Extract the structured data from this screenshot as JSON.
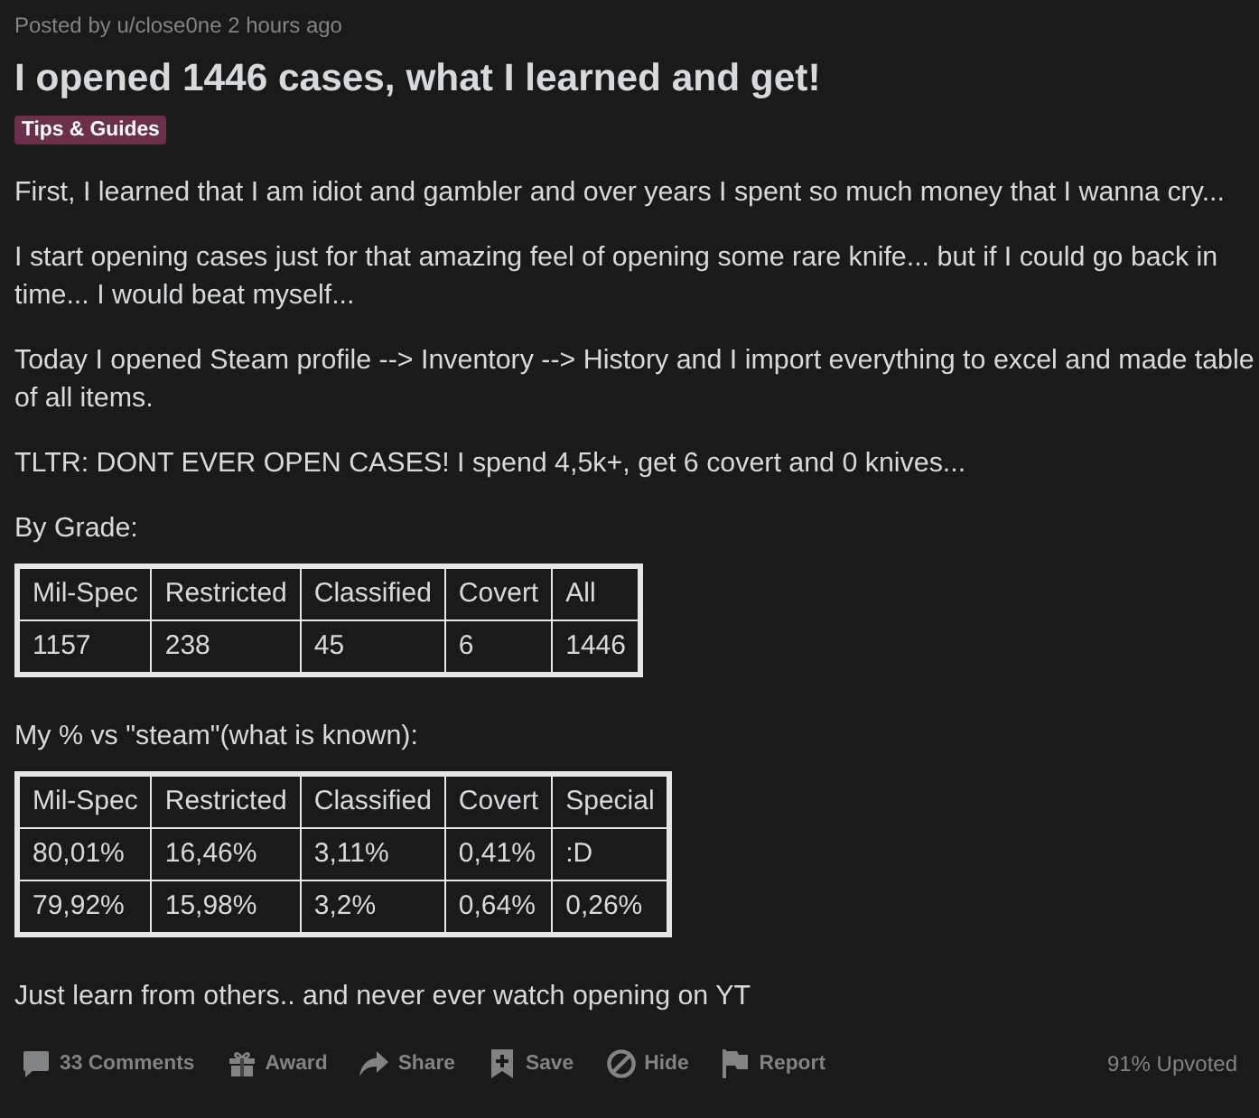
{
  "post": {
    "meta": "Posted by u/close0ne 2 hours ago",
    "title": "I opened 1446 cases, what I learned and get!",
    "flair": "Tips & Guides"
  },
  "body": [
    {
      "kind": "paragraph",
      "text": "First, I learned that I am idiot and gambler and over years I spent so much money that I wanna cry..."
    },
    {
      "kind": "paragraph",
      "text": "I start opening cases just for that amazing feel of opening some rare knife... but if I could go back in time... I would beat myself..."
    },
    {
      "kind": "paragraph",
      "text": "Today I opened Steam profile --> Inventory --> History and I import everything to excel and made table of all items."
    },
    {
      "kind": "paragraph",
      "text": "TLTR: DONT EVER OPEN CASES! I spend 4,5k+, get 6 covert and 0 knives..."
    },
    {
      "kind": "paragraph",
      "text": "By Grade:"
    },
    {
      "kind": "table",
      "columns": [
        "Mil-Spec",
        "Restricted",
        "Classified",
        "Covert",
        "All"
      ],
      "rows": [
        [
          "1157",
          "238",
          "45",
          "6",
          "1446"
        ]
      ]
    },
    {
      "kind": "paragraph",
      "text": "My % vs \"steam\"(what is known):"
    },
    {
      "kind": "table",
      "columns": [
        "Mil-Spec",
        "Restricted",
        "Classified",
        "Covert",
        "Special"
      ],
      "rows": [
        [
          "80,01%",
          "16,46%",
          "3,11%",
          "0,41%",
          ":D"
        ],
        [
          "79,92%",
          "15,98%",
          "3,2%",
          "0,64%",
          "0,26%"
        ]
      ]
    },
    {
      "kind": "paragraph",
      "text": "Just learn from others.. and never ever watch opening on YT"
    }
  ],
  "actions": [
    {
      "kind": "comments",
      "label": "33 Comments"
    },
    {
      "kind": "award",
      "label": "Award"
    },
    {
      "kind": "share",
      "label": "Share"
    },
    {
      "kind": "save",
      "label": "Save"
    },
    {
      "kind": "hide",
      "label": "Hide"
    },
    {
      "kind": "report",
      "label": "Report"
    }
  ],
  "upvote_ratio": "91% Upvoted"
}
